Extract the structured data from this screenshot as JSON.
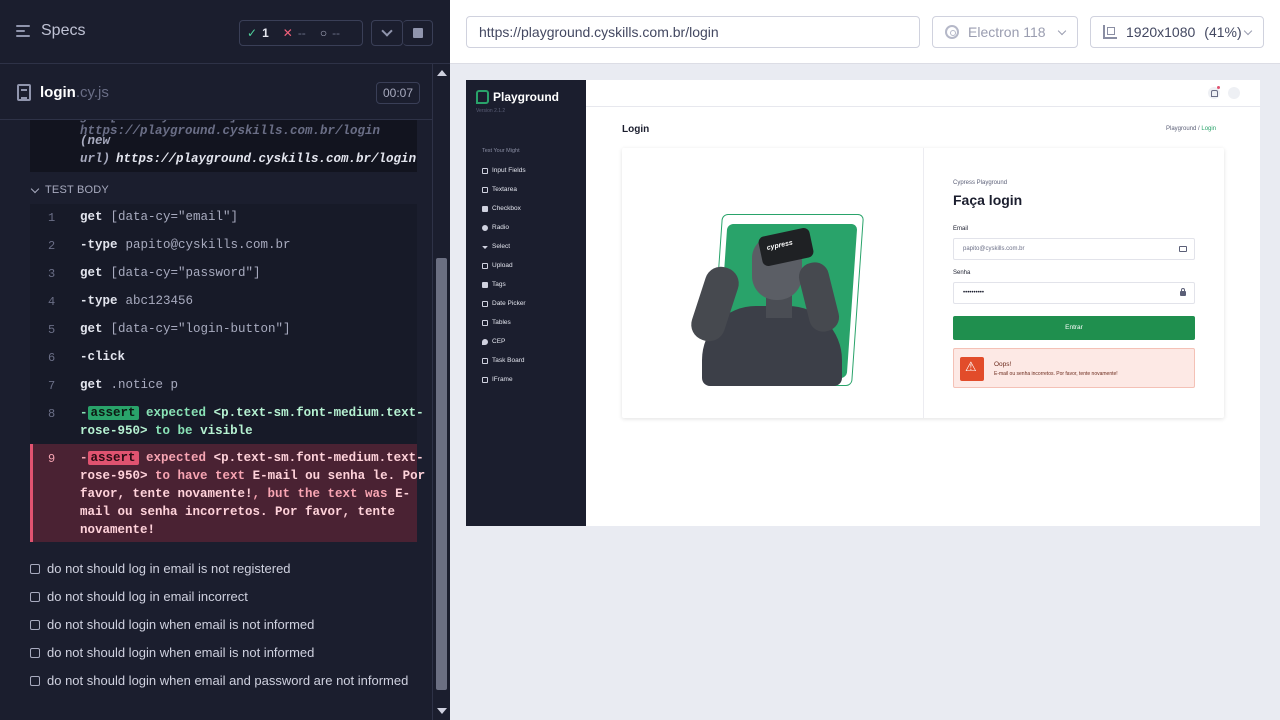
{
  "runner": {
    "header": {
      "specs_label": "Specs",
      "passed_count": "1",
      "passed_icon": "✓",
      "failed_icon": "✕",
      "failed_count": "--",
      "pending_icon": "○",
      "pending_count": "--"
    },
    "spec_file": {
      "name": "login",
      "ext": ".cy.js",
      "duration": "00:07"
    },
    "visit_block": {
      "partial_line": "get [data-cy=\"email\"] https://playground.cyskills.com.br/login",
      "label": "(new",
      "label2": "url)",
      "url": "https://playground.cyskills.com.br/login"
    },
    "test_body_label": "TEST BODY",
    "commands": [
      {
        "n": "1",
        "name": "get",
        "arg": "[data-cy=\"email\"]"
      },
      {
        "n": "2",
        "name": "-type",
        "arg": "papito@cyskills.com.br"
      },
      {
        "n": "3",
        "name": "get",
        "arg": "[data-cy=\"password\"]"
      },
      {
        "n": "4",
        "name": "-type",
        "arg": "abc123456"
      },
      {
        "n": "5",
        "name": "get",
        "arg": "[data-cy=\"login-button\"]"
      },
      {
        "n": "6",
        "name": "-click",
        "arg": ""
      },
      {
        "n": "7",
        "name": "get",
        "arg": ".notice p"
      }
    ],
    "assert_pass": {
      "n": "8",
      "dash": "-",
      "badge": "assert",
      "l1_expected": "expected",
      "l1_subject": "<p.text-sm.font-medium.text-",
      "l2_subject": "rose-950>",
      "l2_to_be": "to be",
      "l2_value": "visible"
    },
    "assert_fail": {
      "n": "9",
      "dash": "-",
      "badge": "assert",
      "l1_expected": "expected",
      "l1_subject": "<p.text-sm.font-medium.text-",
      "l2_subject": "rose-950>",
      "l2_have": "to have text",
      "l2_value": "E-mail ou senha le. Por",
      "l3_value": "favor, tente novamente!",
      "l3_but": ", but the text was",
      "l3_actual": "E-",
      "l4_actual": "mail ou senha incorretos. Por favor, tente",
      "l5_actual": "novamente!"
    },
    "tests": [
      "do not should log in email is not registered",
      "do not should log in email incorrect",
      "do not should login when email is not informed",
      "do not should login when email is not informed",
      "do not should login when email and password are not informed"
    ]
  },
  "browser_bar": {
    "url": "https://playground.cyskills.com.br/login",
    "browser": "Electron 118",
    "viewport": "1920x1080",
    "zoom": "(41%)"
  },
  "aut": {
    "logo_text": "Playground",
    "version": "Version 2.1.2",
    "nav_heading": "Test Your Might",
    "nav_items": [
      "Input Fields",
      "Textarea",
      "Checkbox",
      "Radio",
      "Select",
      "Upload",
      "Tags",
      "Date Picker",
      "Tables",
      "CEP",
      "Task Board",
      "IFrame"
    ],
    "page_title": "Login",
    "breadcrumb_root": "Playground /",
    "breadcrumb_current": "Login",
    "illustration_label": "cypress",
    "form": {
      "kicker": "Cypress Playground",
      "title": "Faça login",
      "email_label": "Email",
      "email_value": "papito@cyskills.com.br",
      "password_label": "Senha",
      "password_value": "••••••••••",
      "submit_label": "Entrar"
    },
    "notice": {
      "title": "Oops!",
      "text": "E-mail ou senha incorretos. Por favor, tente novamente!"
    }
  },
  "colors": {
    "runner_bg": "#1b1e2e",
    "pass": "#29a36a",
    "fail": "#e05370",
    "brand_green": "#1f8f4e"
  }
}
